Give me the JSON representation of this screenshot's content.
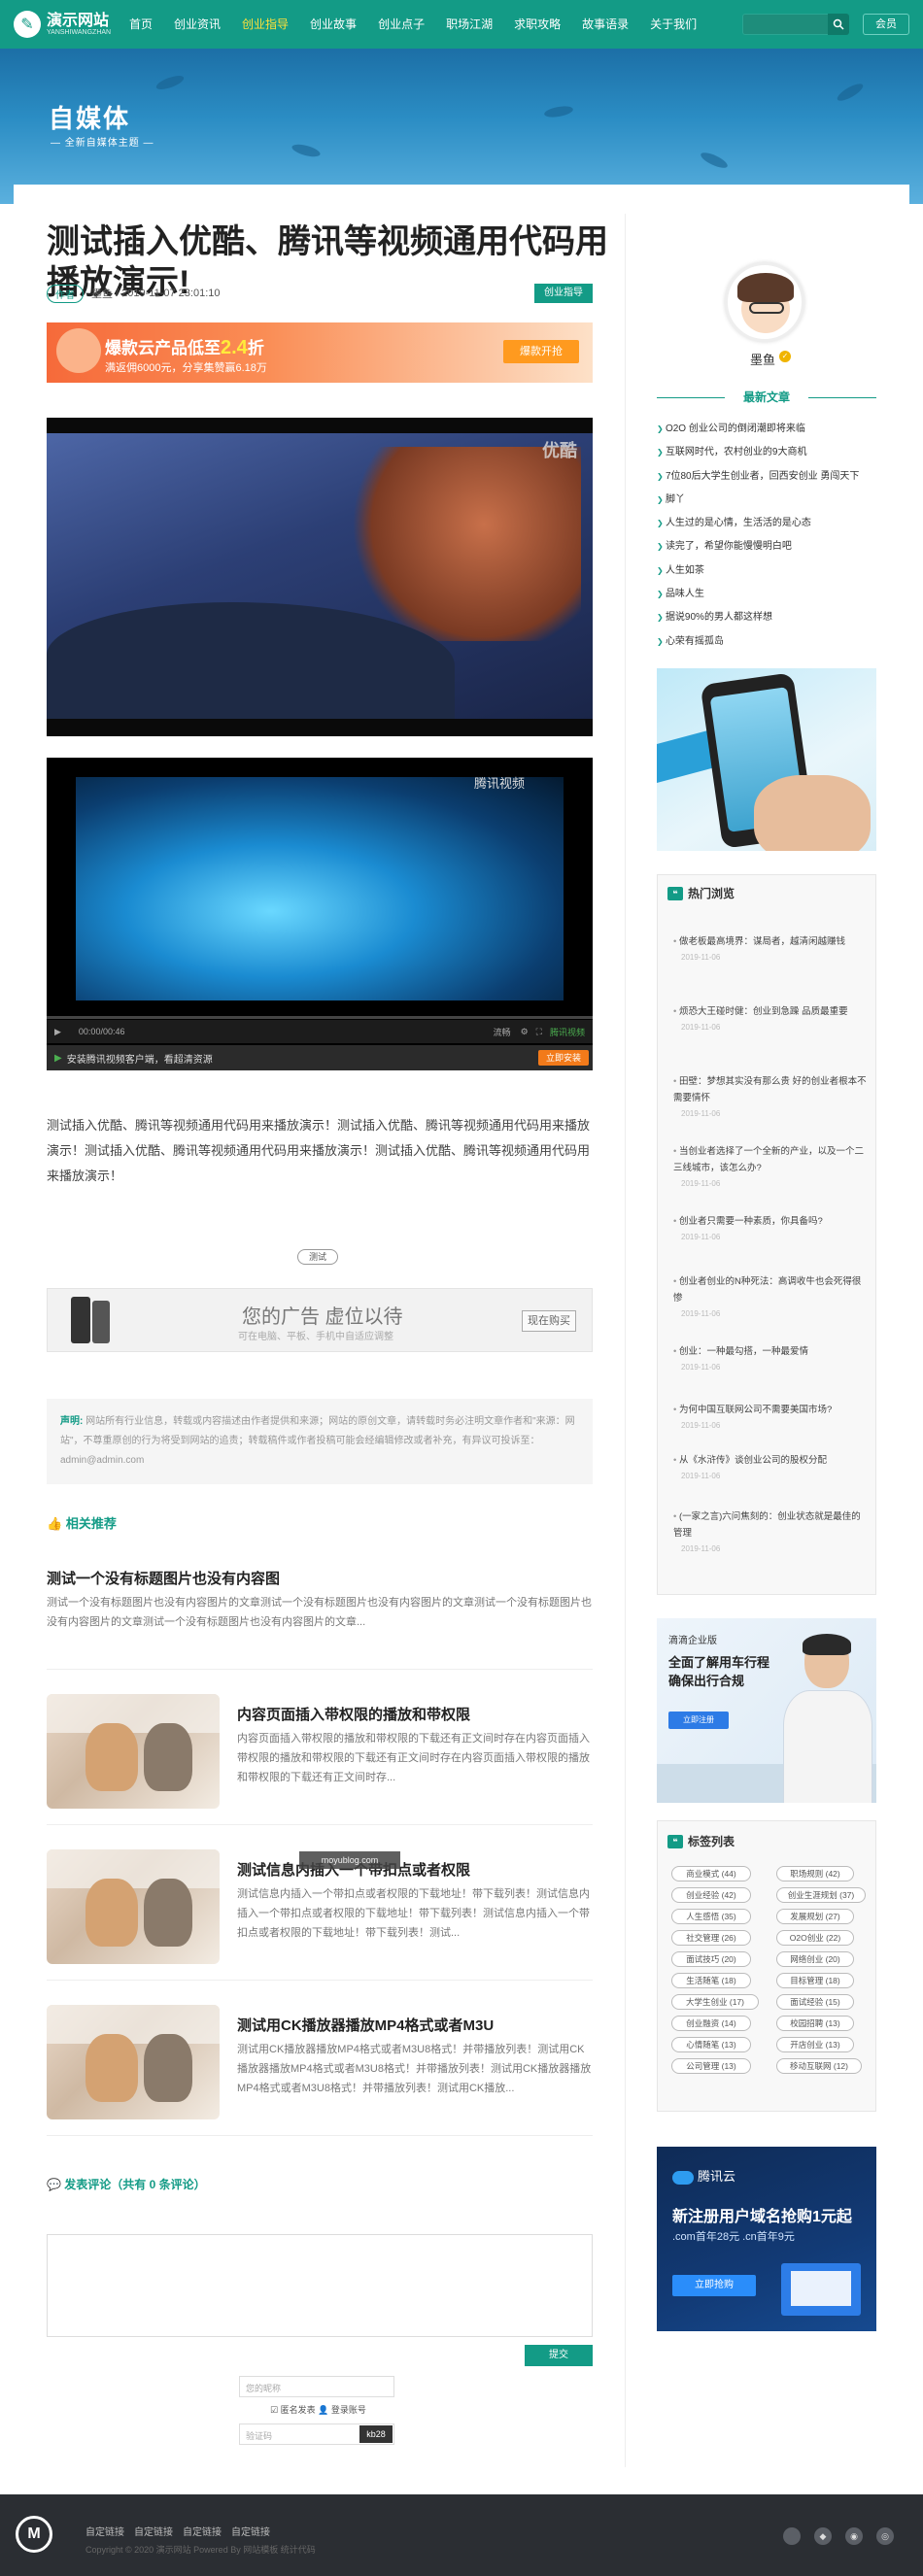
{
  "header": {
    "logo_title": "演示网站",
    "logo_subtitle": "YANSHIWANGZHAN",
    "nav": [
      "首页",
      "创业资讯",
      "创业指导",
      "创业故事",
      "创业点子",
      "职场江湖",
      "求职攻略",
      "故事语录",
      "关于我们"
    ],
    "active_nav_index": 2,
    "member_label": "会员",
    "accent_color": "#139b86"
  },
  "banner": {
    "title": "自媒体",
    "subtitle": "— 全新自媒体主题 —"
  },
  "post": {
    "title": "测试插入优酷、腾讯等视频通用代码用播放演示!",
    "tag": "作者",
    "author": "墨鱼",
    "date": "2019-11-07 23:01:10",
    "category": "创业指导",
    "body": "测试插入优酷、腾讯等视频通用代码用来播放演示！测试插入优酷、腾讯等视频通用代码用来播放演示！测试插入优酷、腾讯等视频通用代码用来播放演示！测试插入优酷、腾讯等视频通用代码用来播放演示！",
    "post_tag": "测试"
  },
  "ad_top": {
    "headline_pre": "爆款云产品低至",
    "headline_price": "2.4",
    "headline_post": "折",
    "sub": "满返佣6000元，分享集赞赢6.18万",
    "button": "爆款开抢"
  },
  "video1": {
    "watermark": "优酷"
  },
  "video2": {
    "brand": "腾讯视频",
    "time": "00:00/00:46",
    "quality": "流畅",
    "bar_right": "腾讯视频",
    "footer_text": "安装腾讯视频客户端，看超清资源",
    "footer_btn": "立即安装"
  },
  "ad_mid": {
    "title": "您的广告 虚位以待",
    "sub": "可在电脑、平板、手机中自适应调整",
    "button": "现在购买"
  },
  "notice": {
    "label": "声明:",
    "text": "网站所有行业信息，转载或内容描述由作者提供和来源；网站的原创文章，请转载时务必注明文章作者和\"来源：网站\"，不尊重原创的行为将受到网站的追责；转载稿件或作者投稿可能会经编辑修改或者补充，有异议可投诉至：",
    "email": "admin@admin.com"
  },
  "related": {
    "heading": "相关推荐",
    "first": {
      "title": "测试一个没有标题图片也没有内容图",
      "desc": "测试一个没有标题图片也没有内容图片的文章测试一个没有标题图片也没有内容图片的文章测试一个没有标题图片也没有内容图片的文章测试一个没有标题图片也没有内容图片的文章..."
    },
    "items": [
      {
        "title": "内容页面插入带权限的播放和带权限",
        "desc": "内容页面插入带权限的播放和带权限的下载还有正文间时存在内容页面插入带权限的播放和带权限的下载还有正文间时存在内容页面插入带权限的播放和带权限的下载还有正文间时存..."
      },
      {
        "title": "测试信息内插入一个带扣点或者权限",
        "desc": "测试信息内插入一个带扣点或者权限的下载地址！带下载列表！测试信息内插入一个带扣点或者权限的下载地址！带下载列表！测试信息内插入一个带扣点或者权限的下载地址！带下载列表！测试..."
      },
      {
        "title": "测试用CK播放器播放MP4格式或者M3U",
        "desc": "测试用CK播放器播放MP4格式或者M3U8格式！并带播放列表！测试用CK播放器播放MP4格式或者M3U8格式！并带播放列表！测试用CK播放器播放MP4格式或者M3U8格式！并带播放列表！测试用CK播放..."
      }
    ],
    "watermark": "moyublog.com"
  },
  "comments": {
    "heading": "发表评论（共有 0 条评论）",
    "submit": "提交",
    "nickname_placeholder": "您的昵称",
    "anon_label": "匿名发表",
    "login_label": "登录账号",
    "captcha_placeholder": "验证码",
    "captcha_code": "kb28"
  },
  "sidebar": {
    "author": "墨鱼",
    "latest_heading": "最新文章",
    "latest": [
      "O2O 创业公司的倒闭潮即将来临",
      "互联网时代，农村创业的9大商机",
      "7位80后大学生创业者，回西安创业 勇闯天下",
      "脚丫",
      "人生过的是心情，生活活的是心态",
      "读完了，希望你能慢慢明白吧",
      "人生如茶",
      "品味人生",
      "据说90%的男人都这样想",
      "心荣有摇孤岛"
    ],
    "hot_heading": "热门浏览",
    "hot": [
      {
        "t": "做老板最高境界：谋局者，越清闲越赚钱",
        "d": "2019-11-06"
      },
      {
        "t": "烦恐大王碰时健：创业到急躁 品质最重要",
        "d": "2019-11-06"
      },
      {
        "t": "田壁：梦想其实没有那么贵 好的创业者根本不需要情怀",
        "d": "2019-11-06"
      },
      {
        "t": "当创业者选择了一个全新的产业，以及一个二三线城市，该怎么办?",
        "d": "2019-11-06"
      },
      {
        "t": "创业者只需要一种素质，你具备吗?",
        "d": "2019-11-06"
      },
      {
        "t": "创业者创业的N种死法：高调收牛也会死得很惨",
        "d": "2019-11-06"
      },
      {
        "t": "创业：一种最勾搭，一种最爱情",
        "d": "2019-11-06"
      },
      {
        "t": "为何中国互联网公司不需要美国市场?",
        "d": "2019-11-06"
      },
      {
        "t": "从《水浒传》谈创业公司的股权分配",
        "d": "2019-11-06"
      },
      {
        "t": "(一家之言)六问焦刻的：创业状态就是最佳的管理",
        "d": "2019-11-06"
      }
    ],
    "ad2": {
      "brand": "滴滴企业版",
      "title": "全面了解用车行程确保出行合规",
      "button": "立即注册"
    },
    "tags_heading": "标签列表",
    "tags": [
      "商业模式 (44)",
      "职场规则 (42)",
      "创业经验 (42)",
      "创业生涯规划 (37)",
      "人生感悟 (35)",
      "发展规划 (27)",
      "社交管理 (26)",
      "O2O创业 (22)",
      "面试技巧 (20)",
      "网络创业 (20)",
      "生活随笔 (18)",
      "目标管理 (18)",
      "大学生创业 (17)",
      "面试经验 (15)",
      "创业融资 (14)",
      "校园招聘 (13)",
      "心情随笔 (13)",
      "开店创业 (13)",
      "公司管理 (13)",
      "移动互联网 (12)"
    ],
    "ad3": {
      "brand": "腾讯云",
      "title": "新注册用户域名抢购1元起",
      "sub": ".com首年28元 .cn首年9元",
      "button": "立即抢购"
    }
  },
  "footer": {
    "links": [
      "自定链接",
      "自定链接",
      "自定链接",
      "自定链接"
    ],
    "copyright": "Copyright © 2020 演示网站 Powered By 网站模板  统计代码",
    "icons": [
      "apple-icon",
      "android-icon",
      "wechat-icon",
      "weibo-icon"
    ]
  }
}
